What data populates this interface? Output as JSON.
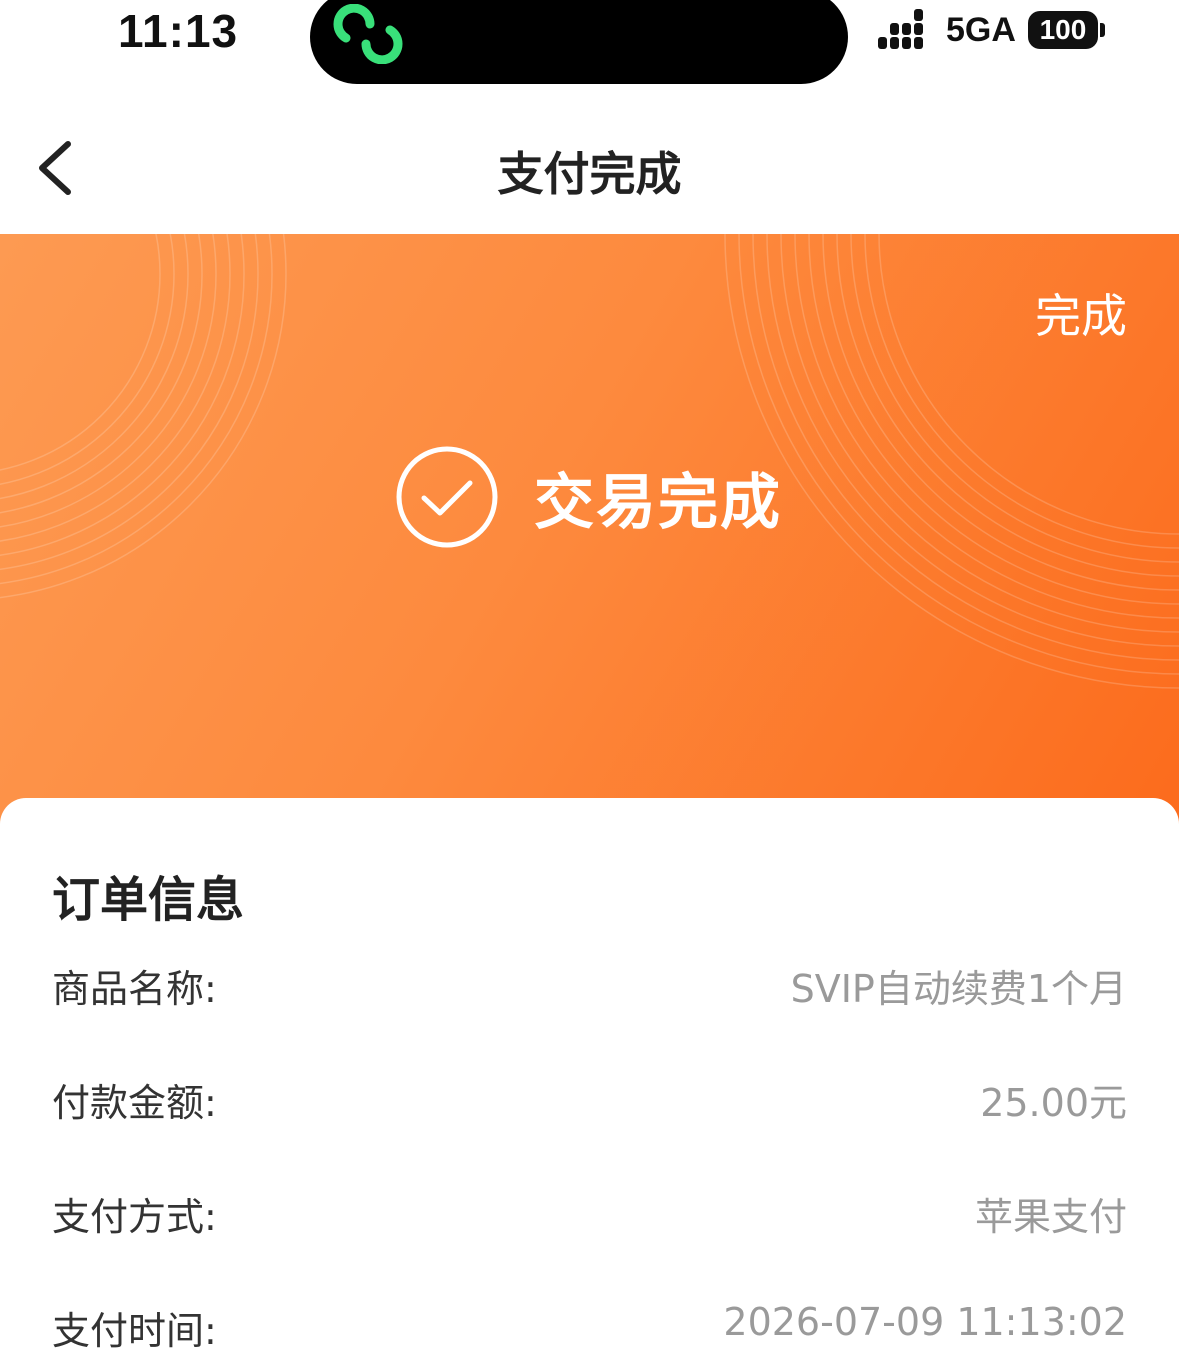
{
  "status_bar": {
    "time": "11:13",
    "network": "5GA",
    "battery": "100"
  },
  "nav": {
    "title": "支付完成"
  },
  "banner": {
    "done_label": "完成",
    "status_text": "交易完成"
  },
  "order": {
    "title": "订单信息",
    "rows": [
      {
        "label": "商品名称:",
        "value": "SVIP自动续费1个月"
      },
      {
        "label": "付款金额:",
        "value": "25.00元"
      },
      {
        "label": "支付方式:",
        "value": "苹果支付"
      },
      {
        "label": "支付时间:",
        "value": "2026-07-09 11:13:02"
      }
    ]
  },
  "colors": {
    "banner_start": "#fd9a52",
    "banner_end": "#fc6b1c",
    "island_icon": "#39e07a"
  }
}
